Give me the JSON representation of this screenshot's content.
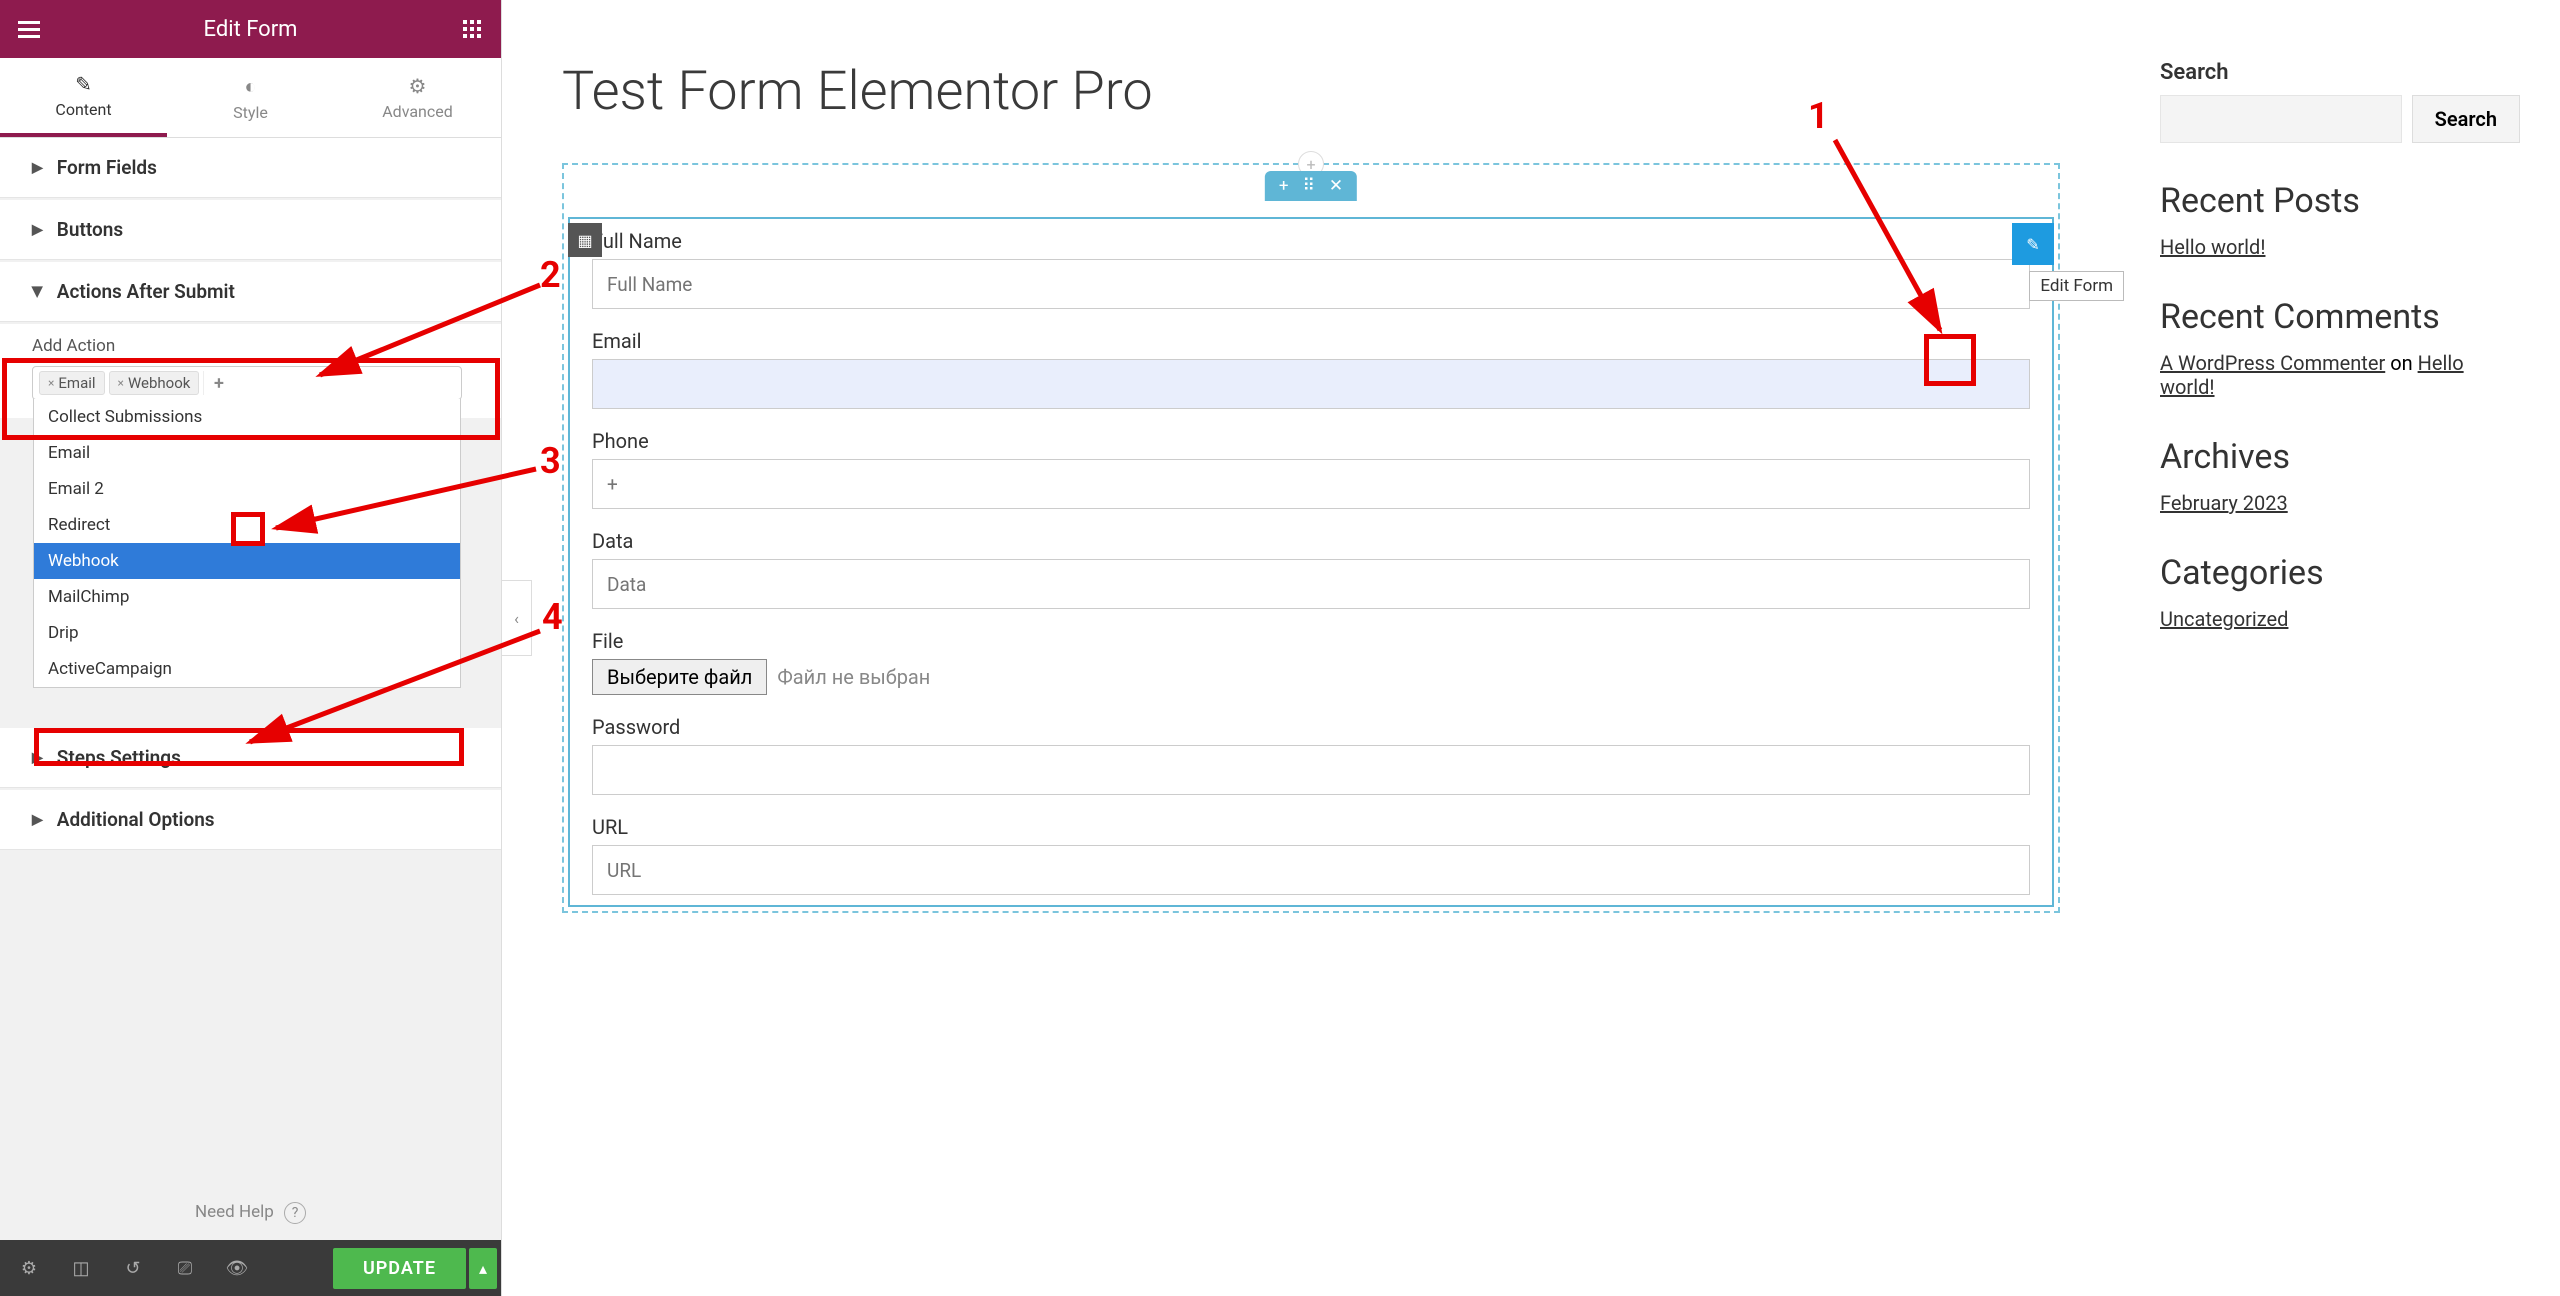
{
  "sidebar": {
    "title": "Edit Form",
    "tabs": [
      "Content",
      "Style",
      "Advanced"
    ],
    "sections": {
      "form_fields": "Form Fields",
      "buttons": "Buttons",
      "actions_after_submit": "Actions After Submit",
      "steps_settings": "Steps Settings",
      "additional_options": "Additional Options"
    },
    "add_action_label": "Add Action",
    "selected_actions": [
      "Email",
      "Webhook"
    ],
    "action_options": [
      "Collect Submissions",
      "Email",
      "Email 2",
      "Redirect",
      "Webhook",
      "MailChimp",
      "Drip",
      "ActiveCampaign"
    ],
    "need_help": "Need Help",
    "update_btn": "UPDATE"
  },
  "canvas": {
    "page_title": "Test Form Elementor Pro",
    "tooltip": "Edit Form",
    "fields": {
      "full_name": {
        "label": "Full Name",
        "placeholder": "Full Name"
      },
      "email": {
        "label": "Email"
      },
      "phone": {
        "label": "Phone",
        "placeholder": "+"
      },
      "data": {
        "label": "Data",
        "placeholder": "Data"
      },
      "file": {
        "label": "File",
        "btn": "Выберите файл",
        "txt": "Файл не выбран"
      },
      "password": {
        "label": "Password"
      },
      "url": {
        "label": "URL",
        "placeholder": "URL"
      }
    }
  },
  "right": {
    "search_label": "Search",
    "search_btn": "Search",
    "recent_posts_h": "Recent Posts",
    "recent_posts": [
      "Hello world!"
    ],
    "recent_comments_h": "Recent Comments",
    "commenter": "A WordPress Commenter",
    "on": " on ",
    "comment_post": "Hello world!",
    "archives_h": "Archives",
    "archives": [
      "February 2023"
    ],
    "categories_h": "Categories",
    "categories": [
      "Uncategorized"
    ]
  },
  "annotations": {
    "n1": "1",
    "n2": "2",
    "n3": "3",
    "n4": "4"
  }
}
